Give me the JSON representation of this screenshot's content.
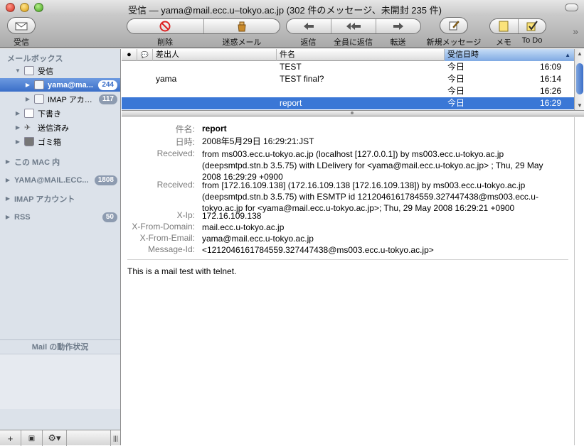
{
  "window": {
    "title": "受信 — yama@mail.ecc.u–tokyo.ac.jp (302 件のメッセージ、未開封 235 件)"
  },
  "toolbar": {
    "get_mail": "受信",
    "delete": "削除",
    "junk": "迷惑メール",
    "reply": "返信",
    "reply_all": "全員に返信",
    "forward": "転送",
    "new_message": "新規メッセージ",
    "note": "メモ",
    "todo": "To Do"
  },
  "sidebar": {
    "mailboxes_header": "メールボックス",
    "inbox": "受信",
    "inbox_accounts": [
      {
        "label": "yama@ma...",
        "count": "244"
      },
      {
        "label": "IMAP アカ…",
        "count": "117"
      }
    ],
    "drafts": "下書き",
    "sent": "送信済み",
    "trash": "ゴミ箱",
    "sections": [
      {
        "label": "この MAC 内",
        "count": ""
      },
      {
        "label": "YAMA@MAIL.ECC...",
        "count": "1808"
      },
      {
        "label": "IMAP アカウント",
        "count": ""
      },
      {
        "label": "RSS",
        "count": "50"
      }
    ],
    "activity_title": "Mail の動作状況"
  },
  "list": {
    "columns": {
      "status": "●",
      "flag": "💬",
      "from": "差出人",
      "subject": "件名",
      "date": "受信日時"
    },
    "rows": [
      {
        "from": "",
        "subject": "TEST",
        "date": "今日",
        "time": "16:09"
      },
      {
        "from": "yama",
        "subject": "TEST final?",
        "date": "今日",
        "time": "16:14"
      },
      {
        "from": "",
        "subject": "",
        "date": "今日",
        "time": "16:26"
      },
      {
        "from": "",
        "subject": "report",
        "date": "今日",
        "time": "16:29"
      }
    ]
  },
  "message": {
    "headers": [
      {
        "label": "件名:",
        "value": "report"
      },
      {
        "label": "日時:",
        "value": "2008年5月29日 16:29:21:JST"
      },
      {
        "label": "Received:",
        "value": "from ms003.ecc.u-tokyo.ac.jp (localhost [127.0.0.1]) by ms003.ecc.u-tokyo.ac.jp (deepsmtpd.stn.b 3.5.75) with LDelivery for <yama@mail.ecc.u-tokyo.ac.jp> ; Thu, 29 May 2008 16:29:29 +0900"
      },
      {
        "label": "Received:",
        "value": "from [172.16.109.138] (172.16.109.138 [172.16.109.138]) by ms003.ecc.u-tokyo.ac.jp (deepsmtpd.stn.b 3.5.75) with ESMTP id 1212046161784559.327447438@ms003.ecc.u-tokyo.ac.jp for <yama@mail.ecc.u-tokyo.ac.jp>; Thu, 29 May 2008 16:29:21 +0900"
      },
      {
        "label": "X-Ip:",
        "value": "172.16.109.138"
      },
      {
        "label": "X-From-Domain:",
        "value": "mail.ecc.u-tokyo.ac.jp"
      },
      {
        "label": "X-From-Email:",
        "value": "yama@mail.ecc.u-tokyo.ac.jp"
      },
      {
        "label": "Message-Id:",
        "value": "<1212046161784559.327447438@ms003.ecc.u-tokyo.ac.jp>"
      }
    ],
    "body": "This is a mail test with telnet."
  },
  "colors": {
    "selection": "#3a77d6",
    "sidebar_bg": "#dce2ea",
    "badge": "#8d9bb0"
  }
}
